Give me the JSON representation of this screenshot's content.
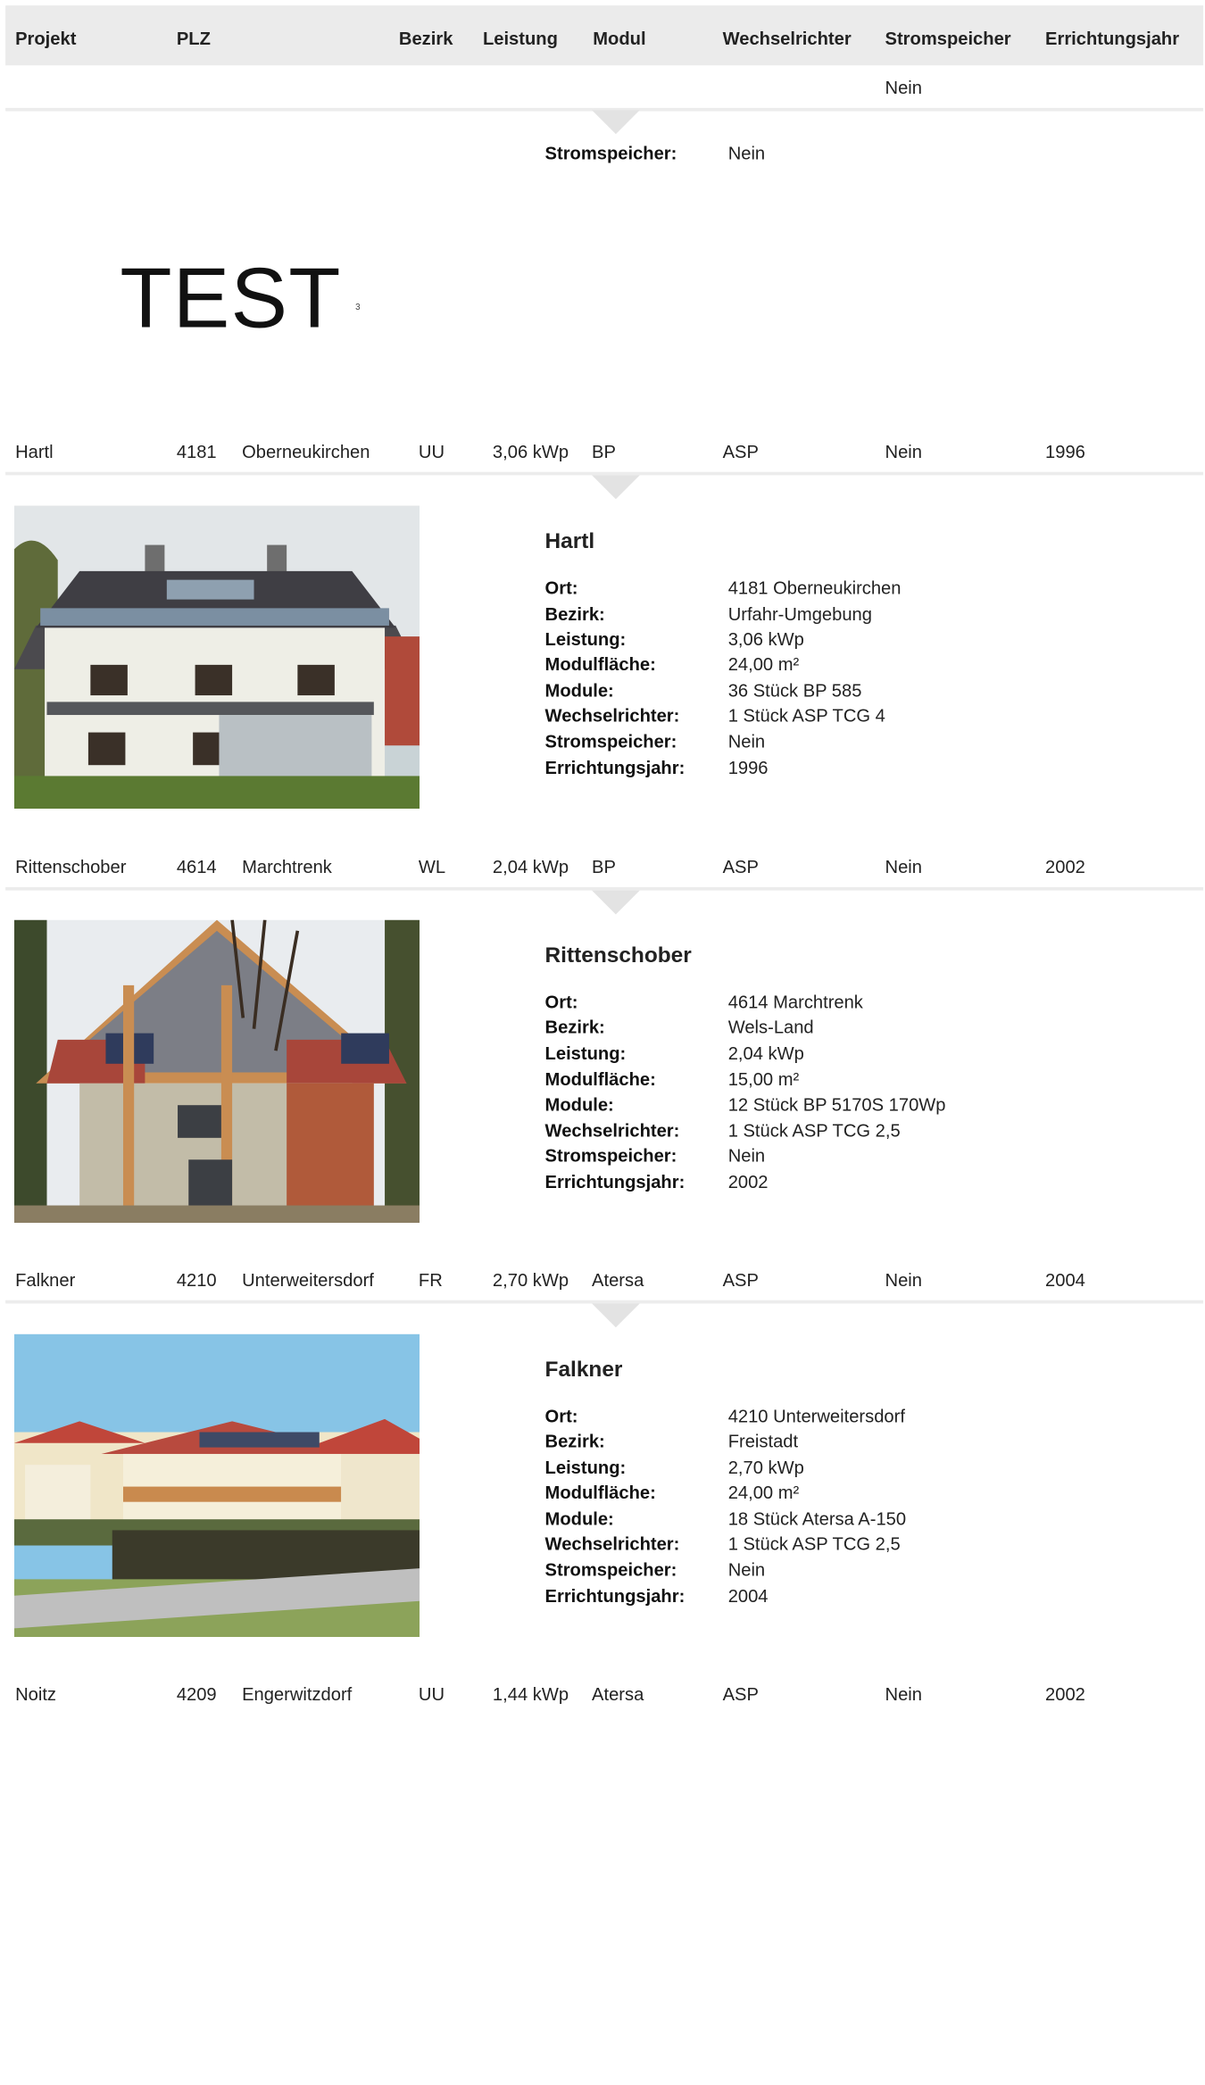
{
  "header": {
    "projekt": "Projekt",
    "plz": "PLZ",
    "bezirk": "Bezirk",
    "leistung": "Leistung",
    "modul": "Modul",
    "wechselrichter": "Wechselrichter",
    "stromspeicher": "Stromspeicher",
    "errichtungsjahr": "Errichtungsjahr"
  },
  "top_row": {
    "stromspeicher": "Nein"
  },
  "test_block": {
    "label_stromspeicher": "Stromspeicher:",
    "value_stromspeicher": "Nein",
    "image_text": "TEST",
    "image_sup": "3"
  },
  "detail_labels": {
    "ort": "Ort:",
    "bezirk": "Bezirk:",
    "leistung": "Leistung:",
    "modulflaeche": "Modulfläche:",
    "module": "Module:",
    "wechselrichter": "Wechselrichter:",
    "stromspeicher": "Stromspeicher:",
    "errichtungsjahr": "Errichtungsjahr:"
  },
  "rows": [
    {
      "projekt": "Hartl",
      "plz": "4181",
      "ort": "Oberneukirchen",
      "bezirk": "UU",
      "leistung": "3,06 kWp",
      "modul": "BP",
      "wechselrichter": "ASP",
      "stromspeicher": "Nein",
      "jahr": "1996",
      "detail": {
        "title": "Hartl",
        "ort": "4181 Oberneukirchen",
        "bezirk": "Urfahr-Umgebung",
        "leistung": "3,06 kWp",
        "modulflaeche": "24,00 m²",
        "module": "36 Stück BP 585",
        "wechselrichter": "1 Stück ASP TCG 4",
        "stromspeicher": "Nein",
        "jahr": "1996"
      }
    },
    {
      "projekt": "Rittenschober",
      "plz": "4614",
      "ort": "Marchtrenk",
      "bezirk": "WL",
      "leistung": "2,04 kWp",
      "modul": "BP",
      "wechselrichter": "ASP",
      "stromspeicher": "Nein",
      "jahr": "2002",
      "detail": {
        "title": "Rittenschober",
        "ort": "4614 Marchtrenk",
        "bezirk": "Wels-Land",
        "leistung": "2,04 kWp",
        "modulflaeche": "15,00 m²",
        "module": "12 Stück BP 5170S 170Wp",
        "wechselrichter": "1 Stück ASP TCG 2,5",
        "stromspeicher": "Nein",
        "jahr": "2002"
      }
    },
    {
      "projekt": "Falkner",
      "plz": "4210",
      "ort": "Unterweitersdorf",
      "bezirk": "FR",
      "leistung": "2,70 kWp",
      "modul": "Atersa",
      "wechselrichter": "ASP",
      "stromspeicher": "Nein",
      "jahr": "2004",
      "detail": {
        "title": "Falkner",
        "ort": "4210 Unterweitersdorf",
        "bezirk": "Freistadt",
        "leistung": "2,70 kWp",
        "modulflaeche": "24,00 m²",
        "module": "18 Stück Atersa A-150",
        "wechselrichter": "1 Stück ASP TCG 2,5",
        "stromspeicher": "Nein",
        "jahr": "2004"
      }
    },
    {
      "projekt": "Noitz",
      "plz": "4209",
      "ort": "Engerwitzdorf",
      "bezirk": "UU",
      "leistung": "1,44 kWp",
      "modul": "Atersa",
      "wechselrichter": "ASP",
      "stromspeicher": "Nein",
      "jahr": "2002"
    }
  ]
}
